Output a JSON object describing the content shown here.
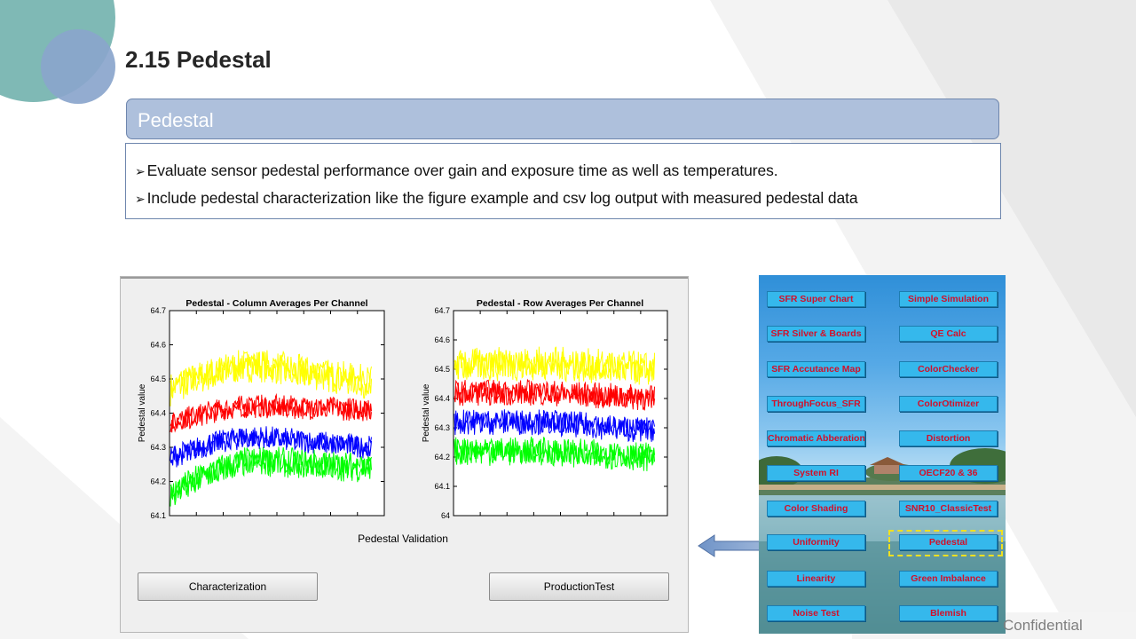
{
  "slide": {
    "title": "2.15  Pedestal",
    "section_header": "Pedestal",
    "bullets": [
      "Evaluate sensor pedestal performance over gain and exposure time as well as temperatures.",
      "Include pedestal characterization like the figure example and csv log output with measured pedestal data"
    ],
    "bullet_arrow": "➢",
    "footer": "Confidential"
  },
  "matlab_window": {
    "caption": "Pedestal Validation",
    "buttons": {
      "characterization": "Characterization",
      "production": "ProductionTest"
    }
  },
  "chart_data": [
    {
      "type": "line",
      "title": "Pedestal - Column Averages Per Channel",
      "xlabel": "",
      "ylabel": "Pedestal value",
      "ylim": [
        64.1,
        64.7
      ],
      "yticks": [
        "64.1",
        "64.2",
        "64.3",
        "64.4",
        "64.5",
        "64.6",
        "64.7"
      ],
      "grid": false,
      "series": [
        {
          "color": "#ffff00",
          "mean_start": 64.47,
          "mean_peak": 64.54,
          "mean_end": 64.49,
          "noise": 0.05
        },
        {
          "color": "#ff0000",
          "mean_start": 64.37,
          "mean_peak": 64.42,
          "mean_end": 64.41,
          "noise": 0.035
        },
        {
          "color": "#0000ff",
          "mean_start": 64.27,
          "mean_peak": 64.33,
          "mean_end": 64.3,
          "noise": 0.035
        },
        {
          "color": "#00ff00",
          "mean_start": 64.16,
          "mean_peak": 64.26,
          "mean_end": 64.24,
          "noise": 0.045
        }
      ]
    },
    {
      "type": "line",
      "title": "Pedestal - Row Averages Per Channel",
      "xlabel": "",
      "ylabel": "Pedestal value",
      "ylim": [
        64.0,
        64.7
      ],
      "yticks": [
        "64",
        "64.1",
        "64.2",
        "64.3",
        "64.4",
        "64.5",
        "64.6",
        "64.7"
      ],
      "grid": false,
      "series": [
        {
          "color": "#ffff00",
          "mean_start": 64.51,
          "mean_peak": 64.52,
          "mean_end": 64.5,
          "noise": 0.06
        },
        {
          "color": "#ff0000",
          "mean_start": 64.42,
          "mean_peak": 64.42,
          "mean_end": 64.4,
          "noise": 0.045
        },
        {
          "color": "#0000ff",
          "mean_start": 64.32,
          "mean_peak": 64.32,
          "mean_end": 64.29,
          "noise": 0.045
        },
        {
          "color": "#00ff00",
          "mean_start": 64.22,
          "mean_peak": 64.22,
          "mean_end": 64.2,
          "noise": 0.05
        }
      ]
    }
  ],
  "tool_panel": {
    "left_buttons": [
      "SFR Super Chart",
      "SFR Silver & Boards",
      "SFR Accutance Map",
      "ThroughFocus_SFR",
      "Chromatic Abberation",
      "System RI",
      "Color Shading",
      "Uniformity",
      "Linearity",
      "Noise Test"
    ],
    "right_buttons": [
      "Simple Simulation",
      "QE Calc",
      "ColorChecker",
      "ColorOtimizer",
      "Distortion",
      "OECF20 & 36",
      "SNR10_ClassicTest",
      "Pedestal",
      "Green Imbalance",
      "Blemish"
    ],
    "highlighted": "Pedestal"
  },
  "colors": {
    "header_fill": "#aec0dc",
    "border": "#6e86ad",
    "button_fill": "#35b8ec",
    "button_text": "#d2102a",
    "highlight": "#f0e020"
  }
}
